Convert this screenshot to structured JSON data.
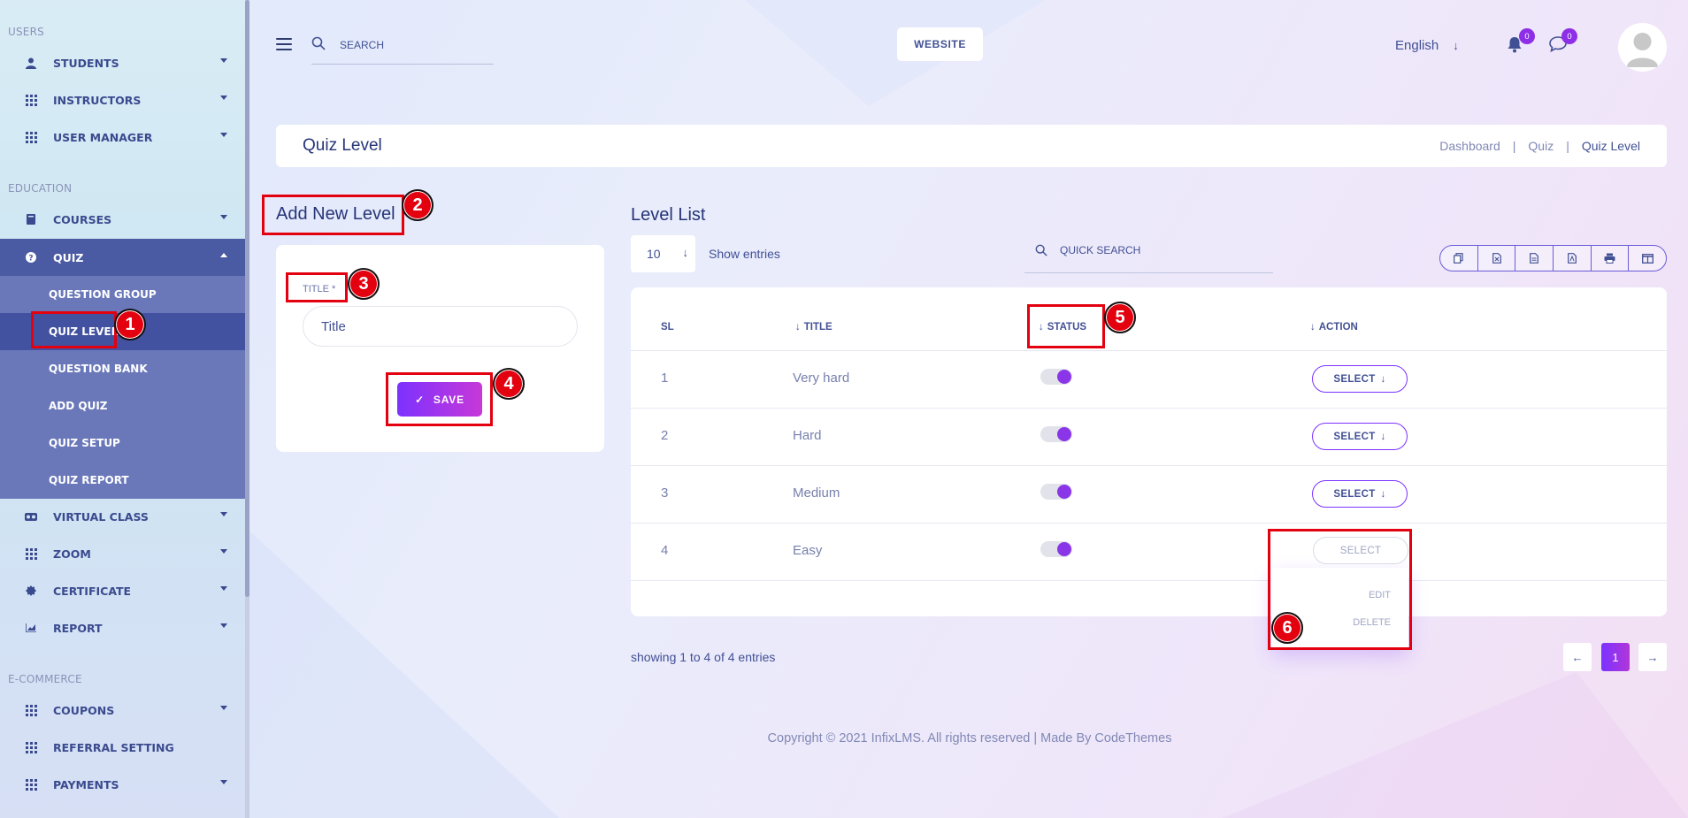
{
  "sidebar": {
    "sections": {
      "users": "USERS",
      "education": "EDUCATION",
      "ecommerce": "E-COMMERCE"
    },
    "items": {
      "students": "STUDENTS",
      "instructors": "INSTRUCTORS",
      "user_manager": "USER MANAGER",
      "courses": "COURSES",
      "quiz": "QUIZ",
      "virtual_class": "VIRTUAL CLASS",
      "zoom": "ZOOM",
      "certificate": "CERTIFICATE",
      "report": "REPORT",
      "coupons": "COUPONS",
      "referral_setting": "REFERRAL SETTING",
      "payments": "PAYMENTS"
    },
    "quiz_sub": {
      "question_group": "QUESTION GROUP",
      "quiz_level": "QUIZ LEVEL",
      "question_bank": "QUESTION BANK",
      "add_quiz": "ADD QUIZ",
      "quiz_setup": "QUIZ SETUP",
      "quiz_report": "QUIZ REPORT"
    }
  },
  "topbar": {
    "search_placeholder": "SEARCH",
    "website_label": "WEBSITE",
    "language": "English",
    "notification_count": "0",
    "message_count": "0"
  },
  "header": {
    "title": "Quiz Level",
    "breadcrumb": [
      "Dashboard",
      "Quiz",
      "Quiz Level"
    ],
    "separator": "|"
  },
  "form": {
    "heading": "Add New Level",
    "title_label": "TITLE *",
    "title_placeholder": "Title",
    "save_label": "SAVE"
  },
  "list": {
    "heading": "Level List",
    "entries_value": "10",
    "show_entries": "Show entries",
    "quick_search_placeholder": "QUICK SEARCH",
    "columns": {
      "sl": "SL",
      "title": "TITLE",
      "status": "STATUS",
      "action": "ACTION"
    },
    "rows": [
      {
        "sl": "1",
        "title": "Very hard",
        "status_on": true,
        "action": "SELECT"
      },
      {
        "sl": "2",
        "title": "Hard",
        "status_on": true,
        "action": "SELECT"
      },
      {
        "sl": "3",
        "title": "Medium",
        "status_on": true,
        "action": "SELECT"
      },
      {
        "sl": "4",
        "title": "Easy",
        "status_on": true,
        "action": "SELECT"
      }
    ],
    "dropdown": {
      "edit": "EDIT",
      "delete": "DELETE"
    },
    "showing": "showing 1 to 4 of 4 entries",
    "current_page": "1"
  },
  "footer": {
    "copyright": "Copyright © 2021 InfixLMS. All rights reserved | Made By CodeThemes"
  },
  "annotations": [
    "1",
    "2",
    "3",
    "4",
    "5",
    "6"
  ],
  "colors": {
    "accent": "#7c32ff",
    "accent_end": "#c738d8",
    "sidebar_active": "#4a5aa3",
    "annotation": "#e3000f"
  }
}
